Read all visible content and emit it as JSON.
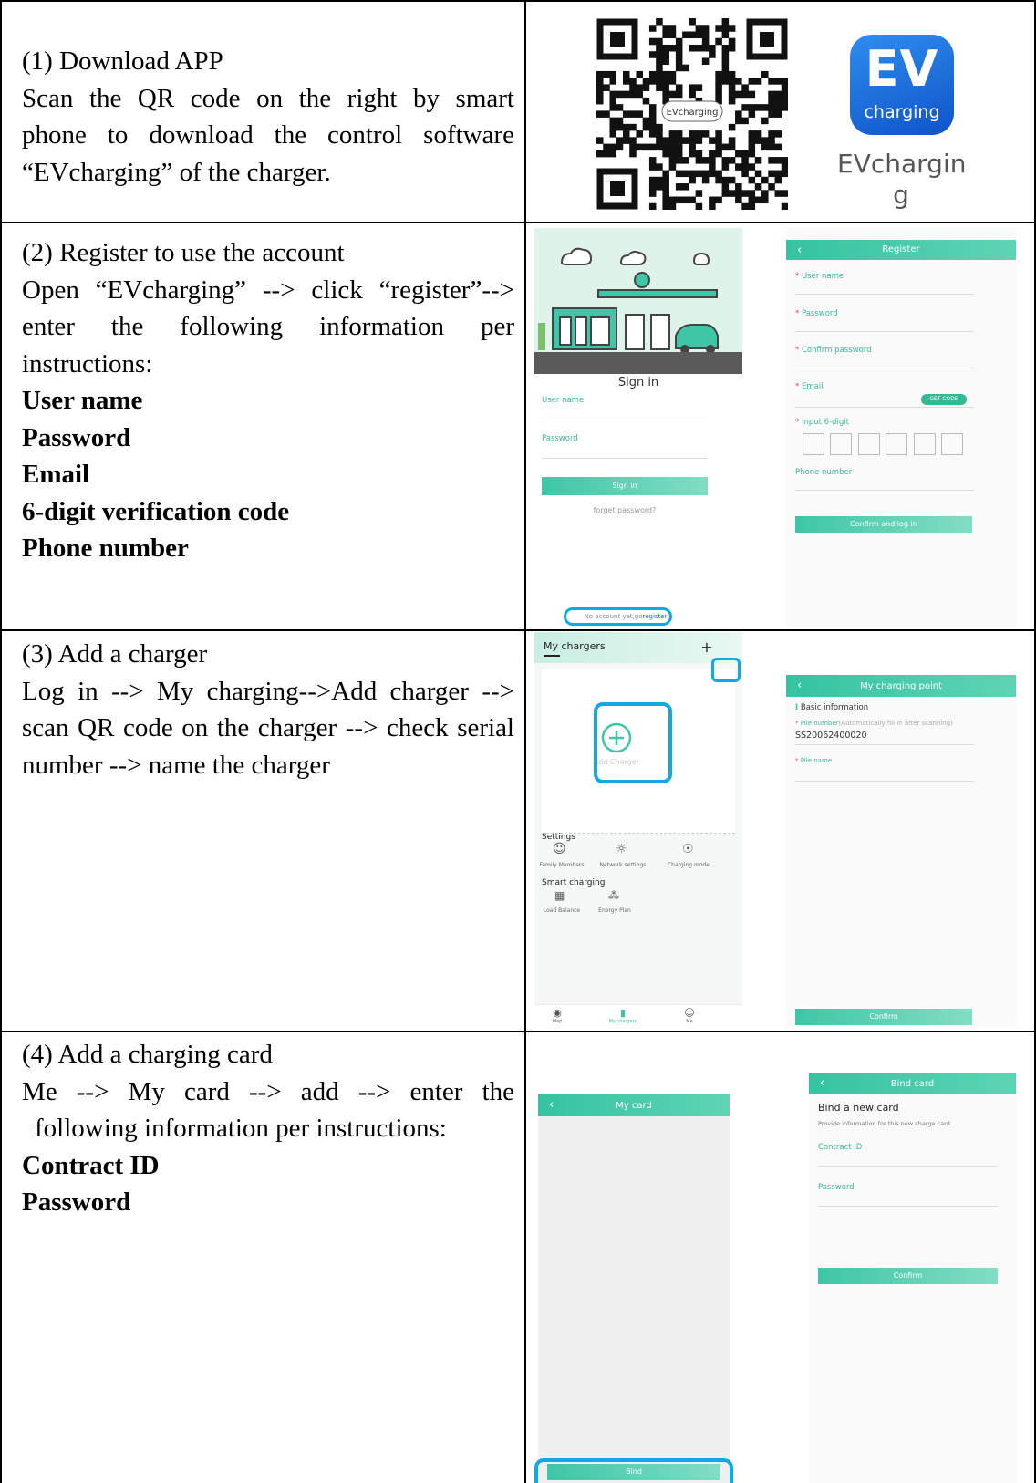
{
  "sections": [
    {
      "heading": "(1)  Download APP",
      "lines": [
        "Scan the QR code on the right by smart",
        "phone to download the control software",
        "“EVcharging” of the charger."
      ],
      "bold": []
    },
    {
      "heading": "(2)  Register to use the account",
      "lines": [
        "Open “EVcharging” --> click “register”-->",
        "enter the following information per",
        "instructions:"
      ],
      "bold": [
        "User name",
        "Password",
        "Email",
        "6-digit verification code",
        "Phone number"
      ]
    },
    {
      "heading": "(3)  Add a charger",
      "lines": [
        "Log in --> My charging-->Add charger -->",
        "scan QR code on the charger --> check serial",
        "number --> name the charger"
      ],
      "bold": []
    },
    {
      "heading": "(4)  Add a charging card",
      "lines": [
        "Me --> My card --> add --> enter the",
        "following information per instructions:"
      ],
      "bold": [
        "Contract ID",
        "Password"
      ]
    }
  ],
  "app_icon": {
    "logo_big": "EV",
    "logo_small": "charging",
    "name_line1": "EVchargin",
    "name_line2": "g"
  },
  "qr": {
    "center_label": "EVcharging"
  },
  "signin": {
    "title": "Sign in",
    "user_label": "User name",
    "password_label": "Password",
    "button": "Sign in",
    "forgot": "forget password?",
    "register_prefix": "No account yet,go",
    "register_link": "register"
  },
  "register": {
    "title": "Register",
    "user_name": "User name",
    "password": "Password",
    "confirm_password": "Confirm password",
    "email": "Email",
    "get_code": "GET CODE",
    "input_digits": "Input 6-digit",
    "phone": "Phone number",
    "button": "Confirm and log in"
  },
  "chargers": {
    "title": "My chargers",
    "add_icon": "+",
    "add_label": "Add Charger",
    "settings_title": "Settings",
    "settings_items": [
      "Family Members",
      "Network settings",
      "Charging mode"
    ],
    "smart_title": "Smart charging",
    "smart_items": [
      "Load Balance",
      "Energy Plan"
    ],
    "nav": [
      "Map",
      "My chargers",
      "Me"
    ]
  },
  "charging_point": {
    "title": "My charging point",
    "section": "Basic information",
    "pile_number_label": "Pile number",
    "pile_number_hint": "(Automatically fill in after scanning)",
    "pile_number_value": "SS20062400020",
    "pile_name_label": "Pile name",
    "button": "Confirm"
  },
  "my_card": {
    "title": "My card",
    "button": "Bind"
  },
  "bind_card": {
    "title": "Bind card",
    "heading": "Bind a new card",
    "subtitle": "Provide information for this new charge card.",
    "contract_label": "Contract ID",
    "password_label": "Password",
    "button": "Confirm"
  },
  "colors": {
    "accent": "#3ec6a6",
    "highlight": "#12a9e3",
    "icon_blue": "#1565d8"
  },
  "icons": {
    "back": "chevron-left-icon",
    "add": "plus-icon",
    "add_circle": "plus-circle-icon"
  }
}
